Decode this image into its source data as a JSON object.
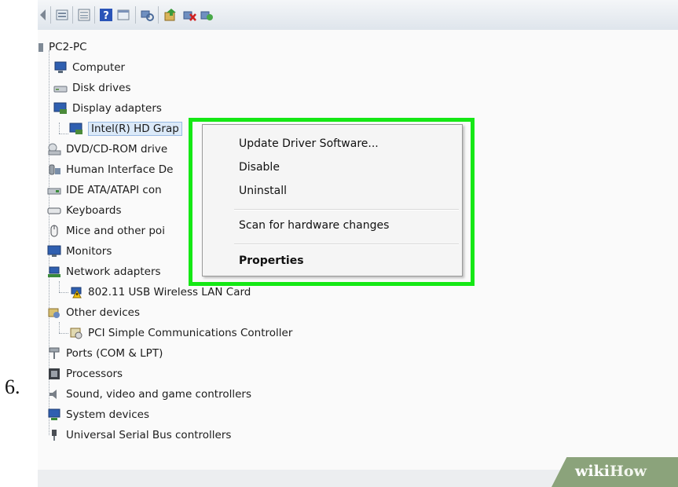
{
  "step_number": "6.",
  "toolbar": {
    "icons": [
      "back-arrow-icon",
      "properties-icon",
      "view-icon",
      "help-icon",
      "console-icon",
      "scan-icon",
      "update-driver-icon",
      "uninstall-icon",
      "enable-icon"
    ]
  },
  "tree": {
    "root": "PC2-PC",
    "items": [
      {
        "label": "Computer",
        "icon": "computer-icon"
      },
      {
        "label": "Disk drives",
        "icon": "disk-drive-icon"
      },
      {
        "label": "Display adapters",
        "icon": "display-adapter-icon"
      },
      {
        "label": "Intel(R) HD Grap",
        "icon": "display-adapter-icon"
      },
      {
        "label": "DVD/CD-ROM drive",
        "icon": "dvd-drive-icon"
      },
      {
        "label": "Human Interface De",
        "icon": "hid-icon"
      },
      {
        "label": "IDE ATA/ATAPI con",
        "icon": "ide-controller-icon"
      },
      {
        "label": "Keyboards",
        "icon": "keyboard-icon"
      },
      {
        "label": "Mice and other poi",
        "icon": "mouse-icon"
      },
      {
        "label": "Monitors",
        "icon": "monitor-icon"
      },
      {
        "label": "Network adapters",
        "icon": "network-adapter-icon"
      },
      {
        "label": "802.11 USB Wireless LAN Card",
        "icon": "warning-network-icon"
      },
      {
        "label": "Other devices",
        "icon": "other-devices-icon"
      },
      {
        "label": "PCI Simple Communications Controller",
        "icon": "unknown-device-icon"
      },
      {
        "label": "Ports (COM & LPT)",
        "icon": "port-icon"
      },
      {
        "label": "Processors",
        "icon": "processor-icon"
      },
      {
        "label": "Sound, video and game controllers",
        "icon": "speaker-icon"
      },
      {
        "label": "System devices",
        "icon": "system-devices-icon"
      },
      {
        "label": "Universal Serial Bus controllers",
        "icon": "usb-icon"
      }
    ]
  },
  "context_menu": {
    "items": [
      "Update Driver Software...",
      "Disable",
      "Uninstall",
      "Scan for hardware changes",
      "Properties"
    ]
  },
  "watermark": {
    "part1": "wiki",
    "part2": "How"
  },
  "colors": {
    "highlight": "#15e815",
    "watermark_bg": "#8ba37b"
  }
}
